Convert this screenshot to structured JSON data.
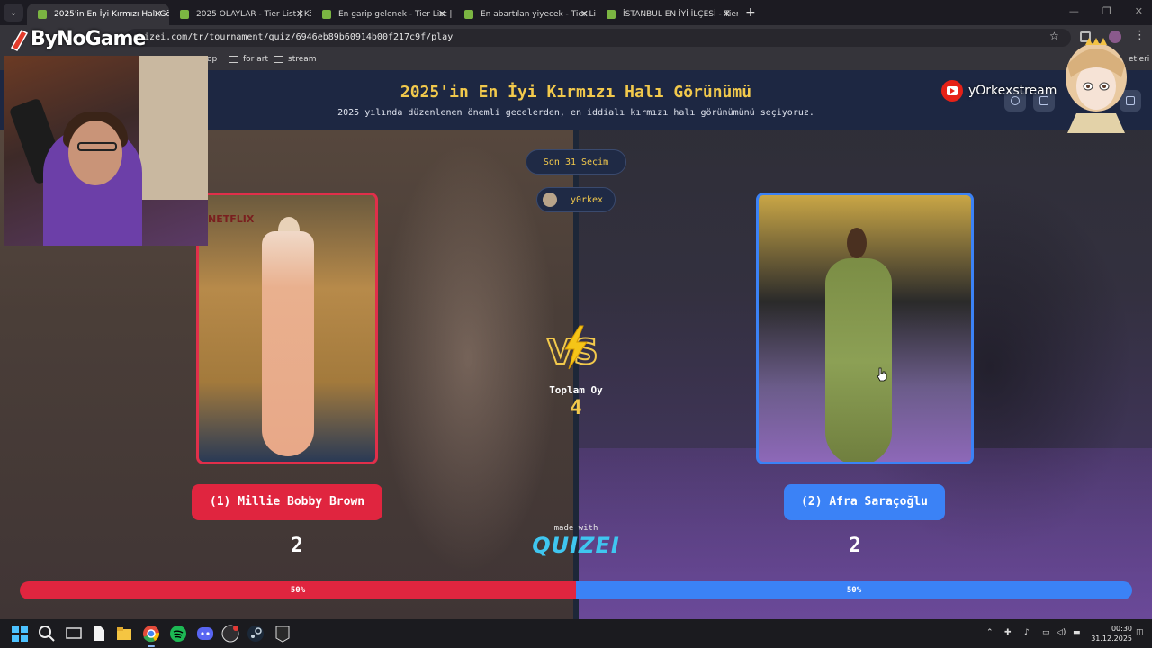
{
  "browser": {
    "tabs": [
      {
        "title": "2025'in En İyi Kırmızı Halı Görün",
        "active": true
      },
      {
        "title": "2025 OLAYLAR - Tier List | Kör",
        "active": false
      },
      {
        "title": "En garip gelenek - Tier List | Kö",
        "active": false
      },
      {
        "title": "En abartılan yiyecek - Tier List |",
        "active": false
      },
      {
        "title": "İSTANBUL EN İYİ İLÇESİ - Tier Li",
        "active": false
      }
    ],
    "url": "quizei.com/tr/tournament/quiz/6946eb89b60914b00f217c9f/play",
    "bookmarks": [
      "op",
      "for art",
      "stream"
    ],
    "bookmarks_right": "etleri"
  },
  "quiz": {
    "title": "2025'in En İyi Kırmızı Halı Görünümü",
    "subtitle": "2025 yılında düzenlenen önemli gecelerden, en iddialı kırmızı halı görünümünü seçiyoruz.",
    "round": "Son 31 Seçim",
    "user": "y0rkex",
    "total_label": "Toplam Oy",
    "total_votes": "4",
    "left": {
      "name": "(1) Millie Bobby Brown",
      "score": "2",
      "percent_label": "50%",
      "share": 0.5,
      "color": "#e0253f"
    },
    "right": {
      "name": "(2) Afra Saraçoğlu",
      "score": "2",
      "percent_label": "50%",
      "share": 0.5,
      "color": "#3b82f6"
    },
    "made_with": "made with",
    "brand": "QUIZEI",
    "photo_text_left": "NETFLIX"
  },
  "overlay": {
    "sponsor": "ByNoGame",
    "youtube_handle": "yOrkexstream"
  },
  "taskbar": {
    "time": "00:30",
    "date": "31.12.2025"
  }
}
